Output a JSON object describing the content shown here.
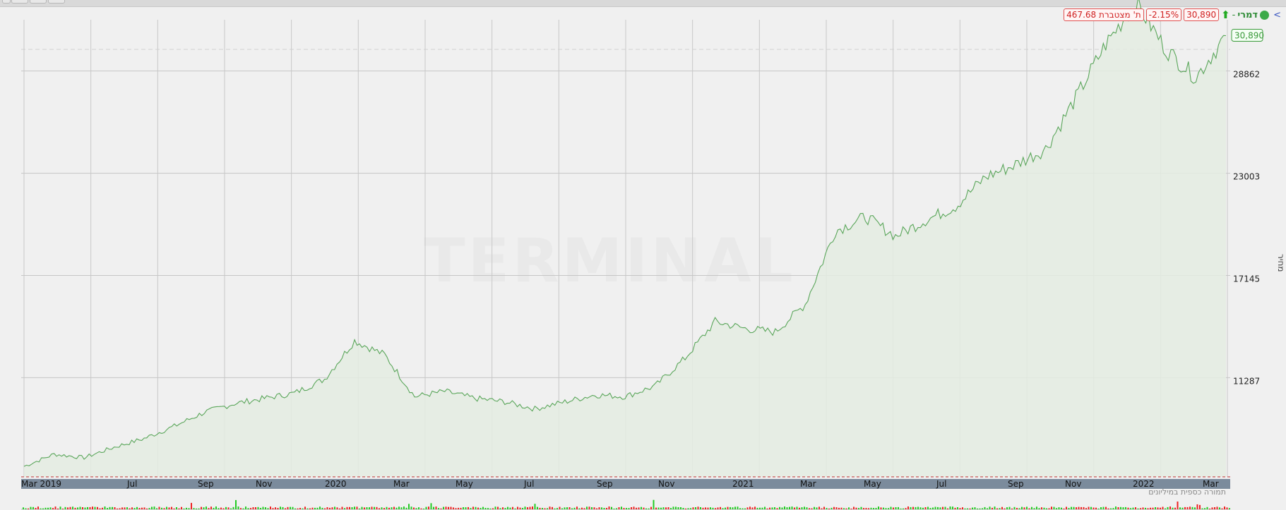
{
  "header": {
    "arrow": "<",
    "name": "דמרי",
    "separator": "-",
    "up_arrow": "🠕",
    "last_price": "30,890",
    "change_pct": "-2.15%",
    "market_cap": "467.68 ת' מצטברת"
  },
  "watermark": "TERMINAL",
  "volume_label": "תמורה כספית במיליונים",
  "side_label": "מחיר",
  "colors": {
    "line": "#5aa65a",
    "fill": "#e4ece2",
    "last_price_box": "#3a9a3a",
    "axis_bar": "#7b8b9c",
    "vol_up": "#22cc22",
    "vol_down": "#ee2222"
  },
  "chart_data": {
    "type": "area",
    "y_ticks": [
      11287,
      17145,
      23003,
      28862
    ],
    "last_value_label": "30,890",
    "last_value": 30890,
    "ylim": [
      5600,
      31800
    ],
    "x_ticks": [
      "Mar 2019",
      "Jul",
      "Sep",
      "Nov",
      "2020",
      "Mar",
      "May",
      "Jul",
      "Sep",
      "Nov",
      "2021",
      "Mar",
      "May",
      "Jul",
      "Sep",
      "Nov",
      "2022",
      "Mar"
    ],
    "series": [
      {
        "dates": [
          "2019-03",
          "2019-04",
          "2019-05",
          "2019-06",
          "2019-07",
          "2019-08",
          "2019-09",
          "2019-10",
          "2019-11",
          "2019-12",
          "2020-01",
          "2020-02",
          "2020-02b",
          "2020-03",
          "2020-04",
          "2020-05",
          "2020-06",
          "2020-07",
          "2020-08",
          "2020-09",
          "2020-10",
          "2020-11",
          "2020-11b",
          "2020-12",
          "2021-01",
          "2021-02",
          "2021-03",
          "2021-04",
          "2021-05",
          "2021-06",
          "2021-07",
          "2021-08",
          "2021-09",
          "2021-10",
          "2021-11",
          "2021-12",
          "2022-01",
          "2022-01b",
          "2022-02",
          "2022-03",
          "2022-03b"
        ],
        "values": [
          6200,
          6900,
          6700,
          7300,
          7800,
          8500,
          9300,
          9800,
          10100,
          10400,
          11200,
          13400,
          12600,
          10200,
          10500,
          10100,
          9900,
          9500,
          9900,
          10300,
          10200,
          10800,
          12400,
          14500,
          14100,
          13900,
          15500,
          19700,
          20500,
          19400,
          20300,
          21100,
          22800,
          23500,
          24400,
          27300,
          30400,
          32800,
          30100,
          28500,
          30890
        ]
      }
    ]
  }
}
